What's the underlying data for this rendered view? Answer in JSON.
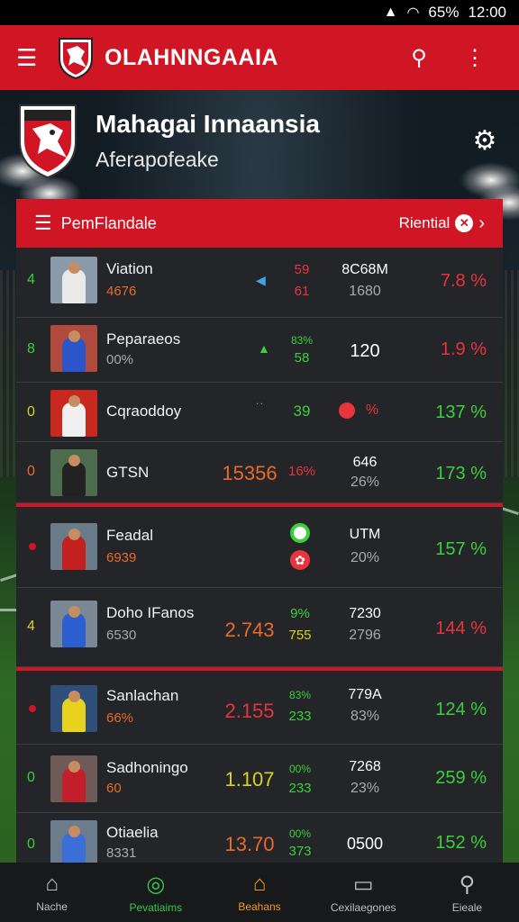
{
  "status": {
    "time": "12:00",
    "battery": "65%"
  },
  "appbar": {
    "title": "OLAHNNGAAIA",
    "menu_icon": "menu-icon",
    "search_icon": "search-icon",
    "more_icon": "more-vert-icon"
  },
  "team": {
    "name": "Mahagai Innaansia",
    "subtitle": "Aferapofeake"
  },
  "card": {
    "title": "PemFlandale",
    "right_label": "Riential"
  },
  "rows": [
    {
      "rank": "4",
      "name": "Viation",
      "sub": "4676",
      "c1a": "59",
      "c1b": "61",
      "big": "",
      "c2a": "8C68M",
      "c2b": "1680",
      "pct": "7.8 %"
    },
    {
      "rank": "8",
      "name": "Peparaeos",
      "sub": "00%",
      "c1a": "83%",
      "c1b": "58",
      "big": "",
      "c2a": "120",
      "c2b": "",
      "pct": "1.9 %"
    },
    {
      "rank": "0",
      "name": "Cqraoddoy",
      "sub": "",
      "c1a": "39",
      "c1b": "",
      "big": "",
      "c2a": "%",
      "c2b": "",
      "pct": "137 %"
    },
    {
      "rank": "0",
      "name": "GTSN",
      "sub": "",
      "c1a": "16%",
      "c1b": "",
      "big": "15356",
      "c2a": "646",
      "c2b": "26%",
      "pct": "173 %"
    },
    {
      "rank": "",
      "name": "Feadal",
      "sub": "6939",
      "c1a": "",
      "c1b": "",
      "big": "",
      "c2a": "UTM",
      "c2b": "20%",
      "pct": "157 %"
    },
    {
      "rank": "4",
      "name": "Doho IFanos",
      "sub": "6530",
      "c1a": "9%",
      "c1b": "755",
      "big": "2.743",
      "c2a": "7230",
      "c2b": "2796",
      "pct": "144 %"
    },
    {
      "rank": "",
      "name": "Sanlachan",
      "sub": "66%",
      "c1a": "83%",
      "c1b": "233",
      "big": "2.155",
      "c2a": "779A",
      "c2b": "83%",
      "pct": "124 %"
    },
    {
      "rank": "0",
      "name": "Sadhoningo",
      "sub": "60",
      "c1a": "00%",
      "c1b": "233",
      "big": "1.107",
      "c2a": "7268",
      "c2b": "23%",
      "pct": "259 %"
    },
    {
      "rank": "0",
      "name": "Otiaelia",
      "sub": "8331",
      "c1a": "00%",
      "c1b": "373",
      "big": "13.70",
      "c2a": "0500",
      "c2b": "",
      "pct": "152 %"
    }
  ],
  "nav": [
    {
      "label": "Nache",
      "icon": "home-icon"
    },
    {
      "label": "Pevatiaims",
      "icon": "stats-icon"
    },
    {
      "label": "Beahans",
      "icon": "house-icon"
    },
    {
      "label": "Cexilaegones",
      "icon": "folder-icon"
    },
    {
      "label": "Eieale",
      "icon": "search-profile-icon"
    }
  ],
  "colors": {
    "brand_red": "#d01524",
    "green": "#3ccf3c",
    "red": "#e8343c",
    "orange": "#f59a1b"
  }
}
